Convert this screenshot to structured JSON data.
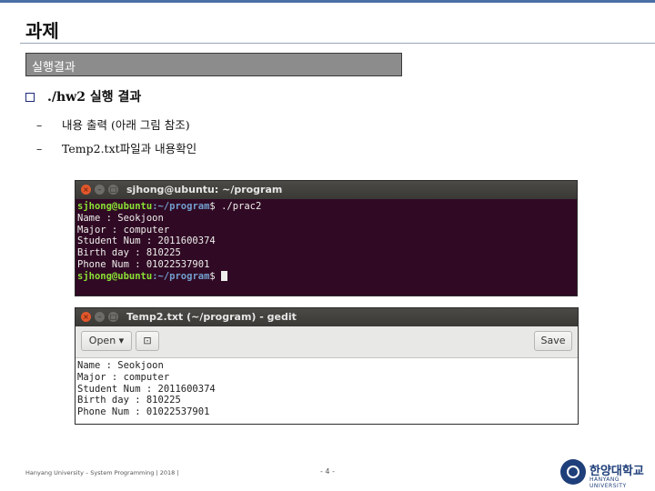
{
  "slide": {
    "title": "과제",
    "section": "실행결과",
    "bullet": "./hw2 실행 결과",
    "sub_items": [
      "내용 출력 (아래 그림 참조)",
      "Temp2.txt파일과  내용확인"
    ],
    "footer": "Hanyang University – System Programming  | 2018 |",
    "page_number": "- 4 -",
    "logo_text": "한양대학교",
    "logo_subtext": "HANYANG UNIVERSITY"
  },
  "terminal": {
    "title": "sjhong@ubuntu: ~/program",
    "prompt_user": "sjhong@ubuntu",
    "prompt_path": ":~/program",
    "prompt_suffix": "$ ",
    "command": "./prac2",
    "output": [
      "Name : Seokjoon",
      "Major : computer",
      "Student Num : 2011600374",
      "Birth day : 810225",
      "Phone Num : 01022537901"
    ]
  },
  "gedit": {
    "title": "Temp2.txt (~/program) - gedit",
    "open_label": "Open",
    "save_label": "Save",
    "lines": [
      "Name : Seokjoon",
      "Major : computer",
      "Student Num : 2011600374",
      "Birth day : 810225",
      "Phone Num : 01022537901"
    ]
  }
}
